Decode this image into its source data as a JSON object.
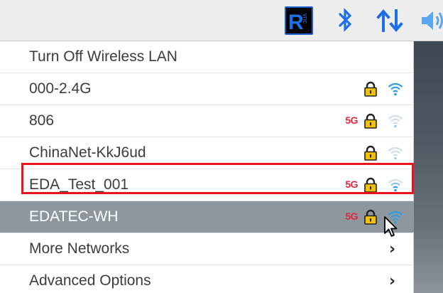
{
  "taskbar": {
    "icons": [
      "vnc-server-icon",
      "bluetooth-icon",
      "network-transfer-icon",
      "volume-icon"
    ],
    "vnc_letter": "R",
    "vnc_small_text": "vnc"
  },
  "menu": {
    "toggle_label": "Turn Off Wireless LAN",
    "networks": [
      {
        "ssid": "000-2.4G",
        "band": "",
        "secured": true,
        "signal": "strong",
        "selected": false
      },
      {
        "ssid": "806",
        "band": "5G",
        "secured": true,
        "signal": "weak",
        "selected": false
      },
      {
        "ssid": "ChinaNet-KkJ6ud",
        "band": "",
        "secured": true,
        "signal": "weak",
        "selected": false
      },
      {
        "ssid": "EDA_Test_001",
        "band": "5G",
        "secured": true,
        "signal": "medium",
        "selected": false
      },
      {
        "ssid": "EDATEC-WH",
        "band": "5G",
        "secured": true,
        "signal": "strong",
        "selected": true
      }
    ],
    "more_networks_label": "More Networks",
    "advanced_options_label": "Advanced Options",
    "submenu_indicator": "›"
  },
  "colors": {
    "band_5g": "#e0263c",
    "lock_yellow": "#f2c200",
    "wifi_blue": "#2f9ee0",
    "selected_row_bg": "#8e979d",
    "highlight_border": "#e8151c",
    "taskbar_blue": "#1e6fe6"
  }
}
